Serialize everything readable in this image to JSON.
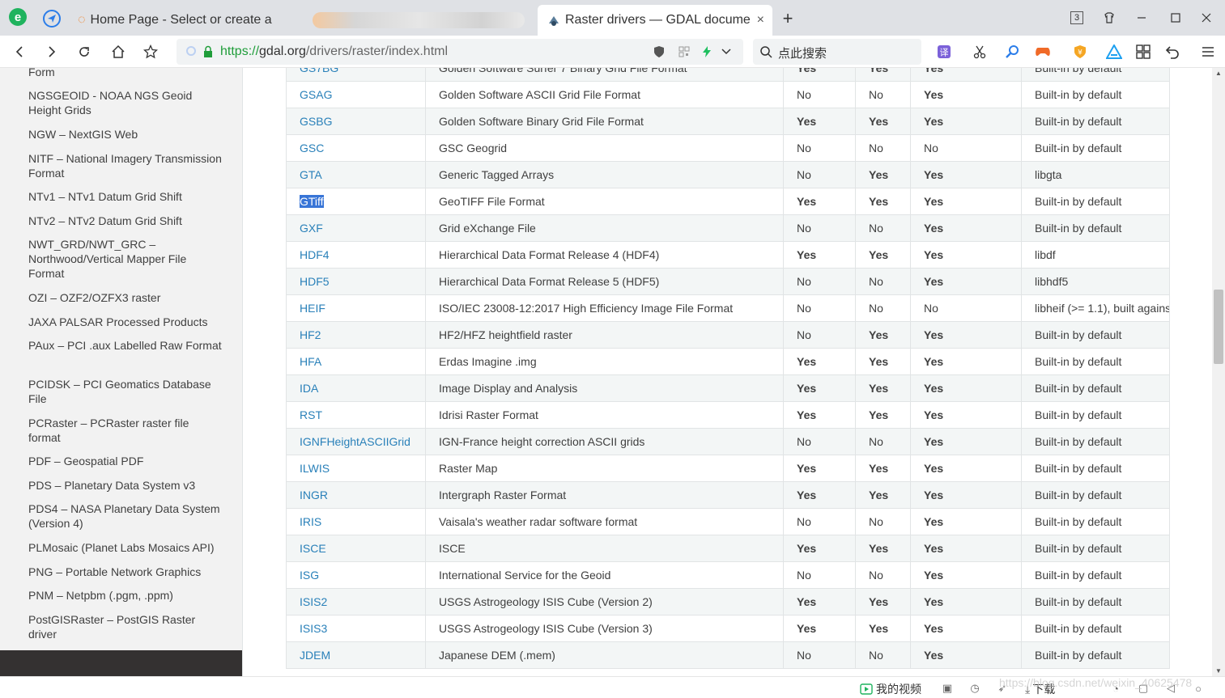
{
  "browser": {
    "tabs": [
      {
        "title": "Home Page - Select or create a",
        "active": false
      },
      {
        "title": "",
        "active": false,
        "blurred": true
      },
      {
        "title": "Raster drivers — GDAL docume",
        "active": true
      }
    ],
    "new_tab_label": "+",
    "close_tab_label": "×",
    "tab_count_badge": "3",
    "url": {
      "scheme": "https://",
      "host": "gdal.org",
      "path": "/drivers/raster/index.html"
    },
    "search_placeholder": "点此搜索",
    "colors": {
      "accent_green": "#1f9d3a",
      "link_blue": "#2980b9",
      "tabbar": "#dfe1e5"
    }
  },
  "sidebar": {
    "items": [
      {
        "label": "Form"
      },
      {
        "label": "NGSGEOID - NOAA NGS Geoid Height Grids"
      },
      {
        "label": "NGW – NextGIS Web"
      },
      {
        "label": "NITF – National Imagery Transmission Format"
      },
      {
        "label": "NTv1 – NTv1 Datum Grid Shift"
      },
      {
        "label": "NTv2 – NTv2 Datum Grid Shift"
      },
      {
        "label": "NWT_GRD/NWT_GRC – Northwood/Vertical Mapper File Format"
      },
      {
        "label": "OZI – OZF2/OZFX3 raster"
      },
      {
        "label": "JAXA PALSAR Processed Products"
      },
      {
        "label": "PAux – PCI .aux Labelled Raw Format"
      },
      {
        "label": "PCIDSK – PCI Geomatics Database File"
      },
      {
        "label": "PCRaster – PCRaster raster file format"
      },
      {
        "label": "PDF – Geospatial PDF"
      },
      {
        "label": "PDS – Planetary Data System v3"
      },
      {
        "label": "PDS4 – NASA Planetary Data System (Version 4)"
      },
      {
        "label": "PLMosaic (Planet Labs Mosaics API)"
      },
      {
        "label": "PNG – Portable Network Graphics"
      },
      {
        "label": "PNM – Netpbm (.pgm, .ppm)"
      },
      {
        "label": "PostGISRaster – PostGIS Raster driver"
      }
    ]
  },
  "table": {
    "rows": [
      {
        "code": "GS7BG",
        "name": "Golden Software Surfer 7 Binary Grid File Format",
        "creation": "Yes",
        "copy": "Yes",
        "geo": "Yes",
        "compiled": "Built-in by default"
      },
      {
        "code": "GSAG",
        "name": "Golden Software ASCII Grid File Format",
        "creation": "No",
        "copy": "No",
        "geo": "Yes",
        "compiled": "Built-in by default"
      },
      {
        "code": "GSBG",
        "name": "Golden Software Binary Grid File Format",
        "creation": "Yes",
        "copy": "Yes",
        "geo": "Yes",
        "compiled": "Built-in by default"
      },
      {
        "code": "GSC",
        "name": "GSC Geogrid",
        "creation": "No",
        "copy": "No",
        "geo": "No",
        "compiled": "Built-in by default"
      },
      {
        "code": "GTA",
        "name": "Generic Tagged Arrays",
        "creation": "No",
        "copy": "Yes",
        "geo": "Yes",
        "compiled": "libgta"
      },
      {
        "code": "GTiff",
        "name": "GeoTIFF File Format",
        "creation": "Yes",
        "copy": "Yes",
        "geo": "Yes",
        "compiled": "Built-in by default",
        "selected": true
      },
      {
        "code": "GXF",
        "name": "Grid eXchange File",
        "creation": "No",
        "copy": "No",
        "geo": "Yes",
        "compiled": "Built-in by default"
      },
      {
        "code": "HDF4",
        "name": "Hierarchical Data Format Release 4 (HDF4)",
        "creation": "Yes",
        "copy": "Yes",
        "geo": "Yes",
        "compiled": "libdf"
      },
      {
        "code": "HDF5",
        "name": "Hierarchical Data Format Release 5 (HDF5)",
        "creation": "No",
        "copy": "No",
        "geo": "Yes",
        "compiled": "libhdf5"
      },
      {
        "code": "HEIF",
        "name": "ISO/IEC 23008-12:2017 High Efficiency Image File Format",
        "creation": "No",
        "copy": "No",
        "geo": "No",
        "compiled": "libheif (>= 1.1), built agains"
      },
      {
        "code": "HF2",
        "name": "HF2/HFZ heightfield raster",
        "creation": "No",
        "copy": "Yes",
        "geo": "Yes",
        "compiled": "Built-in by default"
      },
      {
        "code": "HFA",
        "name": "Erdas Imagine .img",
        "creation": "Yes",
        "copy": "Yes",
        "geo": "Yes",
        "compiled": "Built-in by default"
      },
      {
        "code": "IDA",
        "name": "Image Display and Analysis",
        "creation": "Yes",
        "copy": "Yes",
        "geo": "Yes",
        "compiled": "Built-in by default"
      },
      {
        "code": "RST",
        "name": "Idrisi Raster Format",
        "creation": "Yes",
        "copy": "Yes",
        "geo": "Yes",
        "compiled": "Built-in by default"
      },
      {
        "code": "IGNFHeightASCIIGrid",
        "name": "IGN-France height correction ASCII grids",
        "creation": "No",
        "copy": "No",
        "geo": "Yes",
        "compiled": "Built-in by default"
      },
      {
        "code": "ILWIS",
        "name": "Raster Map",
        "creation": "Yes",
        "copy": "Yes",
        "geo": "Yes",
        "compiled": "Built-in by default"
      },
      {
        "code": "INGR",
        "name": "Intergraph Raster Format",
        "creation": "Yes",
        "copy": "Yes",
        "geo": "Yes",
        "compiled": "Built-in by default"
      },
      {
        "code": "IRIS",
        "name": "Vaisala's weather radar software format",
        "creation": "No",
        "copy": "No",
        "geo": "Yes",
        "compiled": "Built-in by default"
      },
      {
        "code": "ISCE",
        "name": "ISCE",
        "creation": "Yes",
        "copy": "Yes",
        "geo": "Yes",
        "compiled": "Built-in by default"
      },
      {
        "code": "ISG",
        "name": "International Service for the Geoid",
        "creation": "No",
        "copy": "No",
        "geo": "Yes",
        "compiled": "Built-in by default"
      },
      {
        "code": "ISIS2",
        "name": "USGS Astrogeology ISIS Cube (Version 2)",
        "creation": "Yes",
        "copy": "Yes",
        "geo": "Yes",
        "compiled": "Built-in by default"
      },
      {
        "code": "ISIS3",
        "name": "USGS Astrogeology ISIS Cube (Version 3)",
        "creation": "Yes",
        "copy": "Yes",
        "geo": "Yes",
        "compiled": "Built-in by default"
      },
      {
        "code": "JDEM",
        "name": "Japanese DEM (.mem)",
        "creation": "No",
        "copy": "No",
        "geo": "Yes",
        "compiled": "Built-in by default"
      }
    ]
  },
  "statusbar": {
    "my_video_label": "我的视频",
    "download_label": "下载",
    "watermark": "https://blog.csdn.net/weixin_40625478"
  }
}
